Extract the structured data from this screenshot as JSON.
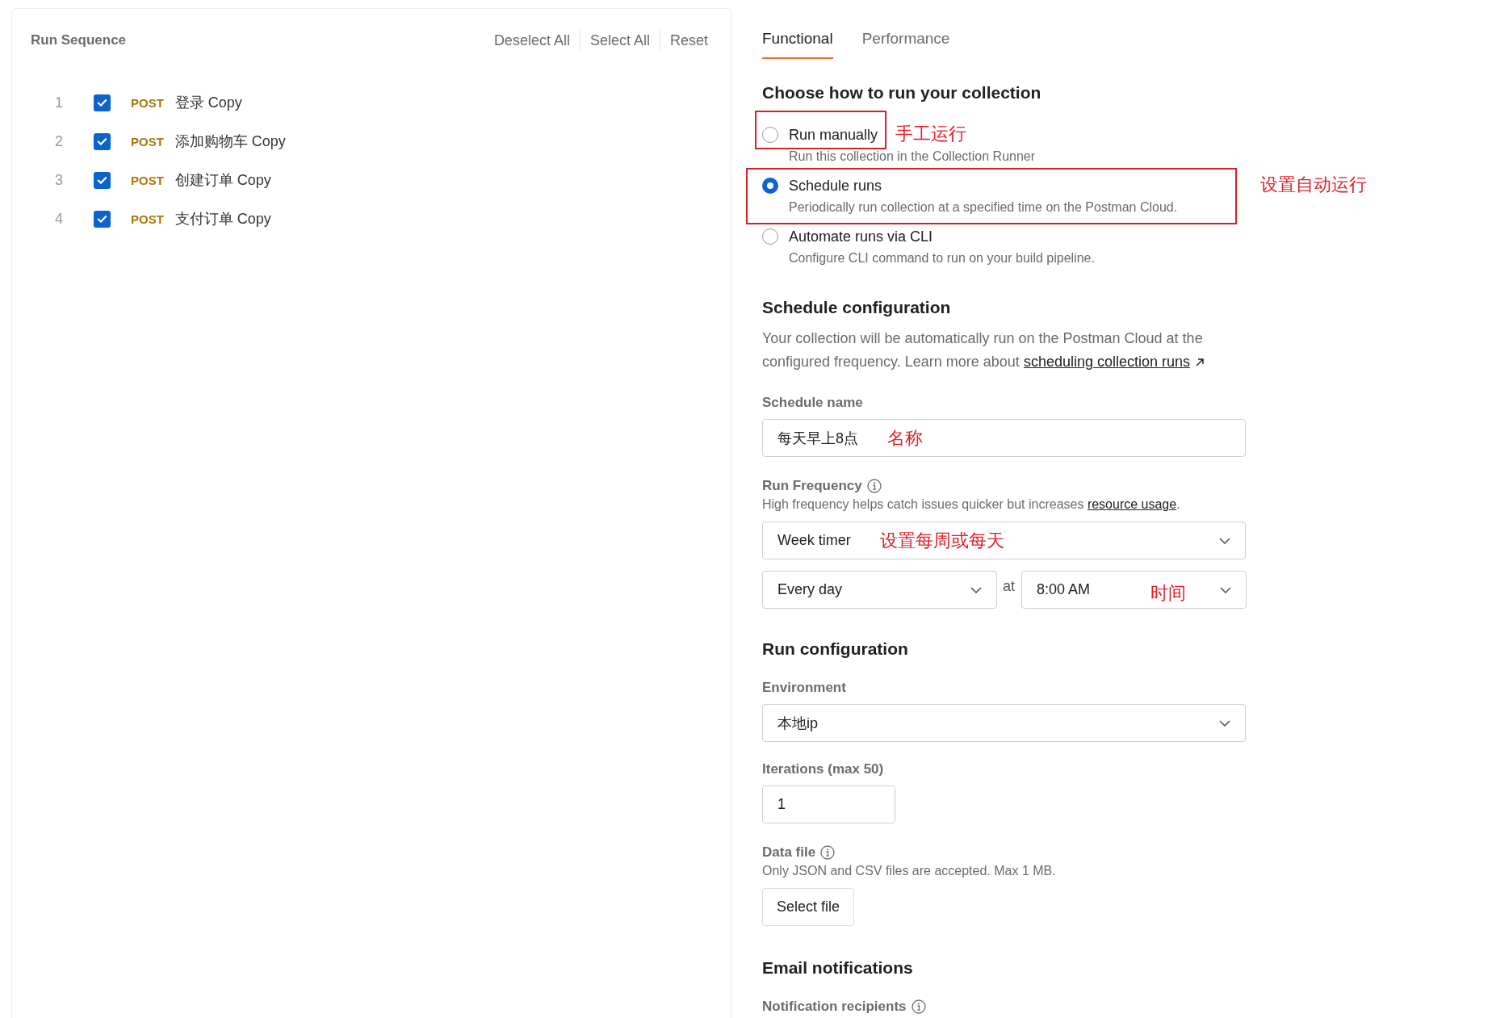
{
  "run_sequence": {
    "title": "Run Sequence",
    "actions": [
      "Deselect All",
      "Select All",
      "Reset"
    ],
    "requests": [
      {
        "number": "1",
        "checked": true,
        "method": "POST",
        "name": "登录 Copy"
      },
      {
        "number": "2",
        "checked": true,
        "method": "POST",
        "name": "添加购物车 Copy"
      },
      {
        "number": "3",
        "checked": true,
        "method": "POST",
        "name": "创建订单 Copy"
      },
      {
        "number": "4",
        "checked": true,
        "method": "POST",
        "name": "支付订单 Copy"
      }
    ]
  },
  "tabs": [
    {
      "label": "Functional",
      "selected": true
    },
    {
      "label": "Performance",
      "selected": false
    }
  ],
  "run_mode": {
    "heading": "Choose how to run your collection",
    "options": [
      {
        "label": "Run manually",
        "description": "Run this collection in the Collection Runner",
        "selected": false,
        "kind": "framed-label",
        "note": "手工运行"
      },
      {
        "label": "Schedule runs",
        "description": "Periodically run collection at a specified time on the Postman Cloud.",
        "selected": true,
        "kind": "framed-whole",
        "note": "设置自动运行"
      },
      {
        "label": "Automate runs via CLI",
        "description": "Configure CLI command to run on your build pipeline.",
        "selected": false,
        "kind": "plain"
      }
    ]
  },
  "schedule": {
    "heading": "Schedule configuration",
    "description": "Your collection will be automatically run on the Postman Cloud at the configured frequency. Learn more about",
    "link": "scheduling collection runs",
    "name_label": "Schedule name",
    "name_value": "每天早上8点",
    "name_note": "名称",
    "frequency_label": "Run Frequency",
    "frequency_hint": "High frequency helps catch issues quicker but increases",
    "frequency_hint_link": "resource usage",
    "frequency_hint_after": ".",
    "timer": "Week timer",
    "timer_note": "设置每周或每天",
    "day": "Every day",
    "at": "at",
    "time": "8:00 AM",
    "time_note": "时间"
  },
  "run_config": {
    "heading": "Run configuration",
    "environment_label": "Environment",
    "environment": "本地ip",
    "iterations_label": "Iterations (max 50)",
    "iterations": "1",
    "data_file_label": "Data file",
    "data_file_hint": "Only JSON and CSV files are accepted. Max 1 MB.",
    "select_file": "Select file"
  },
  "email": {
    "heading": "Email notifications",
    "recipients_label": "Notification recipients"
  }
}
